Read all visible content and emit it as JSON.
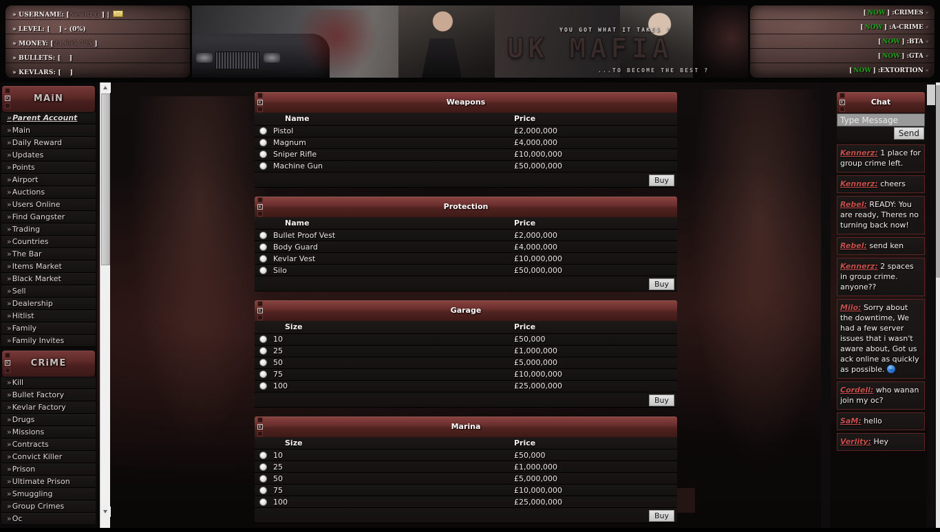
{
  "player": {
    "rows": [
      {
        "label": "» USERNAME:",
        "bracket_open": "[",
        "value": "NewRPG",
        "bracket_close": "]",
        "suffix": "|",
        "icon": "mail-icon"
      },
      {
        "label": "» LEVEL:",
        "bracket_open": "[",
        "value": "",
        "bracket_close": "]",
        "suffix": "- (0%)",
        "icon": ""
      },
      {
        "label": "» MONEY:",
        "bracket_open": "[",
        "value": "24,695,725",
        "bracket_close": "]",
        "suffix": "",
        "icon": ""
      },
      {
        "label": "» BULLETS:",
        "bracket_open": "[",
        "value": "",
        "bracket_close": "]",
        "suffix": "",
        "icon": ""
      },
      {
        "label": "» KEVLARS:",
        "bracket_open": "[",
        "value": "",
        "bracket_close": "]",
        "suffix": "",
        "icon": ""
      }
    ]
  },
  "timers": {
    "ready_label": "NOW",
    "rows": [
      {
        "name": ":CRIMES",
        "value": "NOW"
      },
      {
        "name": ":A-CRIME",
        "value": "NOW"
      },
      {
        "name": ":BTA",
        "value": "NOW"
      },
      {
        "name": ":GTA",
        "value": "NOW"
      },
      {
        "name": ":EXTORTION",
        "value": "NOW"
      }
    ],
    "arrow": "«"
  },
  "banner": {
    "tagline_top": "YOU GOT WHAT IT TAKES ?",
    "logo": "UK MAFIA",
    "tagline_bottom": "...TO BECOME THE BEST ?"
  },
  "sidebar": {
    "sections": [
      {
        "header": "MAiN",
        "items": [
          {
            "label": "Parent Account",
            "style": "parent"
          },
          {
            "label": "Main",
            "style": ""
          },
          {
            "label": "Daily Reward",
            "style": ""
          },
          {
            "label": "Updates",
            "style": ""
          },
          {
            "label": "Points",
            "style": ""
          },
          {
            "label": "Airport",
            "style": ""
          },
          {
            "label": "Auctions",
            "style": ""
          },
          {
            "label": "Users Online",
            "style": ""
          },
          {
            "label": "Find Gangster",
            "style": ""
          },
          {
            "label": "Trading",
            "style": ""
          },
          {
            "label": "Countries",
            "style": ""
          },
          {
            "label": "The Bar",
            "style": ""
          },
          {
            "label": "Items Market",
            "style": ""
          },
          {
            "label": "Black Market",
            "style": ""
          },
          {
            "label": "Sell",
            "style": ""
          },
          {
            "label": "Dealership",
            "style": ""
          },
          {
            "label": "Hitlist",
            "style": ""
          },
          {
            "label": "Family",
            "style": ""
          },
          {
            "label": "Family Invites",
            "style": ""
          }
        ]
      },
      {
        "header": "CRiME",
        "items": [
          {
            "label": "Kill",
            "style": ""
          },
          {
            "label": "Bullet Factory",
            "style": ""
          },
          {
            "label": "Kevlar Factory",
            "style": ""
          },
          {
            "label": "Drugs",
            "style": ""
          },
          {
            "label": "Missions",
            "style": ""
          },
          {
            "label": "Contracts",
            "style": ""
          },
          {
            "label": "Convict Killer",
            "style": ""
          },
          {
            "label": "Prison",
            "style": ""
          },
          {
            "label": "Ultimate Prison",
            "style": ""
          },
          {
            "label": "Smuggling",
            "style": ""
          },
          {
            "label": "Group Crimes",
            "style": ""
          },
          {
            "label": "Oc",
            "style": ""
          }
        ]
      }
    ],
    "chevron": "»"
  },
  "panels": [
    {
      "title": "Weapons",
      "columns": [
        "Name",
        "Price"
      ],
      "rows": [
        {
          "name": "Pistol",
          "price": "£2,000,000"
        },
        {
          "name": "Magnum",
          "price": "£4,000,000"
        },
        {
          "name": "Sniper Rifle",
          "price": "£10,000,000"
        },
        {
          "name": "Machine Gun",
          "price": "£50,000,000"
        }
      ],
      "buy_label": "Buy"
    },
    {
      "title": "Protection",
      "columns": [
        "Name",
        "Price"
      ],
      "rows": [
        {
          "name": "Bullet Proof Vest",
          "price": "£2,000,000"
        },
        {
          "name": "Body Guard",
          "price": "£4,000,000"
        },
        {
          "name": "Kevlar Vest",
          "price": "£10,000,000"
        },
        {
          "name": "Silo",
          "price": "£50,000,000"
        }
      ],
      "buy_label": "Buy"
    },
    {
      "title": "Garage",
      "columns": [
        "Size",
        "Price"
      ],
      "rows": [
        {
          "name": "10",
          "price": "£50,000"
        },
        {
          "name": "25",
          "price": "£1,000,000"
        },
        {
          "name": "50",
          "price": "£5,000,000"
        },
        {
          "name": "75",
          "price": "£10,000,000"
        },
        {
          "name": "100",
          "price": "£25,000,000"
        }
      ],
      "buy_label": "Buy"
    },
    {
      "title": "Marina",
      "columns": [
        "Size",
        "Price"
      ],
      "rows": [
        {
          "name": "10",
          "price": "£50,000"
        },
        {
          "name": "25",
          "price": "£1,000,000"
        },
        {
          "name": "50",
          "price": "£5,000,000"
        },
        {
          "name": "75",
          "price": "£10,000,000"
        },
        {
          "name": "100",
          "price": "£25,000,000"
        }
      ],
      "buy_label": "Buy"
    }
  ],
  "chat": {
    "title": "Chat",
    "input_placeholder": "Type Message",
    "input_value": "",
    "send_label": "Send",
    "messages": [
      {
        "user": "Kennerz:",
        "text": "1 place for group crime left.",
        "emoticon": ""
      },
      {
        "user": "Kennerz:",
        "text": "cheers",
        "emoticon": ""
      },
      {
        "user": "Rebel:",
        "text": "READY: You are ready, Theres no turning back now!",
        "emoticon": ""
      },
      {
        "user": "Rebel:",
        "text": "send ken",
        "emoticon": ""
      },
      {
        "user": "Kennerz:",
        "text": "2 spaces in group crime. anyone??",
        "emoticon": ""
      },
      {
        "user": "Milo:",
        "text": "Sorry about the downtime, We had a few server issues that i wasn't aware about, Got us ack online as quickly as possible.",
        "emoticon": "smiley-icon"
      },
      {
        "user": "Cordell:",
        "text": "who wanan join my oc?",
        "emoticon": ""
      },
      {
        "user": "SaM:",
        "text": "hello",
        "emoticon": ""
      },
      {
        "user": "Verlity:",
        "text": "Hey",
        "emoticon": ""
      }
    ]
  },
  "colors": {
    "accent_red": "#6b302e",
    "ready_green": "#19a018",
    "chat_user": "#c8504c"
  }
}
